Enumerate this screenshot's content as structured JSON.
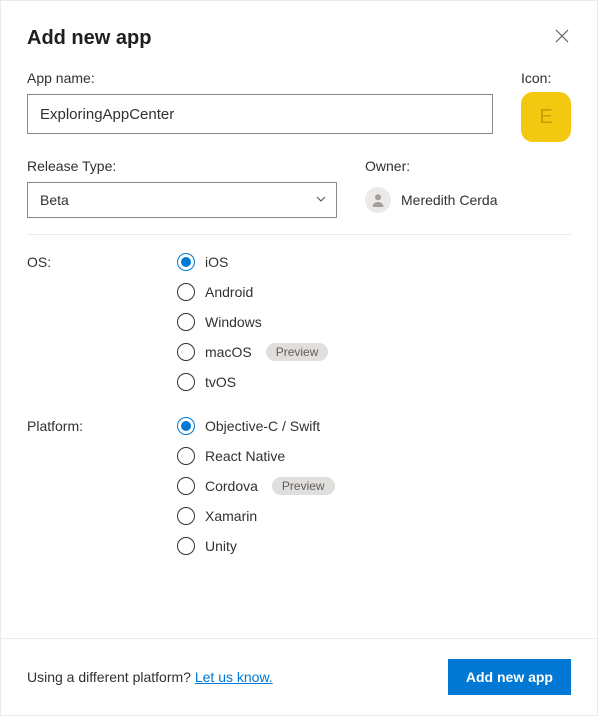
{
  "title": "Add new app",
  "labels": {
    "appName": "App name:",
    "icon": "Icon:",
    "releaseType": "Release Type:",
    "owner": "Owner:",
    "os": "OS:",
    "platform": "Platform:"
  },
  "appName": {
    "value": "ExploringAppCenter",
    "placeholder": "App name"
  },
  "iconLetter": "E",
  "releaseType": {
    "value": "Beta"
  },
  "owner": {
    "name": "Meredith Cerda"
  },
  "os": {
    "options": [
      {
        "label": "iOS",
        "selected": true,
        "preview": false
      },
      {
        "label": "Android",
        "selected": false,
        "preview": false
      },
      {
        "label": "Windows",
        "selected": false,
        "preview": false
      },
      {
        "label": "macOS",
        "selected": false,
        "preview": true
      },
      {
        "label": "tvOS",
        "selected": false,
        "preview": false
      }
    ]
  },
  "platform": {
    "options": [
      {
        "label": "Objective-C / Swift",
        "selected": true,
        "preview": false
      },
      {
        "label": "React Native",
        "selected": false,
        "preview": false
      },
      {
        "label": "Cordova",
        "selected": false,
        "preview": true
      },
      {
        "label": "Xamarin",
        "selected": false,
        "preview": false
      },
      {
        "label": "Unity",
        "selected": false,
        "preview": false
      }
    ]
  },
  "previewBadge": "Preview",
  "footer": {
    "prompt": "Using a different platform? ",
    "linkText": "Let us know.",
    "submit": "Add new app"
  }
}
